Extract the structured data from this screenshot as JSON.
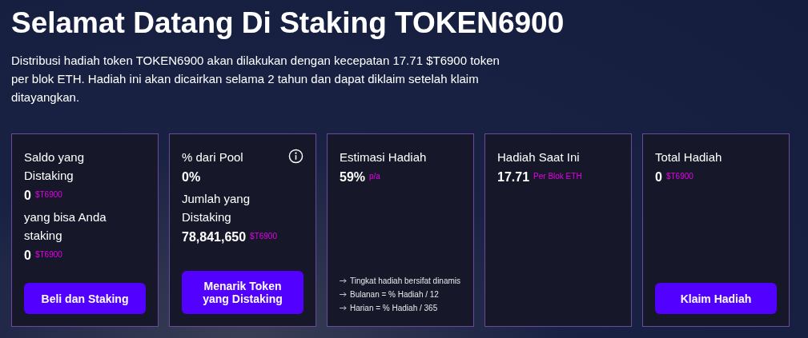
{
  "title": "Selamat Datang Di Staking TOKEN6900",
  "description": "Distribusi hadiah token TOKEN6900 akan dilakukan dengan kecepatan 17.71 $T6900 token per blok ETH. Hadiah ini akan dicairkan selama 2 tahun dan dapat diklaim setelah klaim ditayangkan.",
  "cards": [
    {
      "stats": [
        {
          "label": "Saldo yang Distaking",
          "value": "0",
          "unit": "$T6900"
        },
        {
          "label": "yang bisa Anda staking",
          "value": "0",
          "unit": "$T6900"
        }
      ],
      "button": "Beli dan Staking"
    },
    {
      "info_icon": true,
      "stats": [
        {
          "label": "% dari Pool",
          "value": "0%"
        },
        {
          "label": "Jumlah yang Distaking",
          "value": "78,841,650",
          "unit": "$T6900"
        }
      ],
      "button": "Menarik Token yang Distaking"
    },
    {
      "stats": [
        {
          "label": "Estimasi Hadiah",
          "value": "59%",
          "unit": "p/a"
        }
      ],
      "notes": [
        "Tingkat hadiah bersifat dinamis",
        "Bulanan = % Hadiah / 12",
        "Harian = % Hadiah / 365"
      ]
    },
    {
      "stats": [
        {
          "label": "Hadiah Saat Ini",
          "value": "17.71",
          "unit": "Per Blok ETH"
        }
      ]
    },
    {
      "stats": [
        {
          "label": "Total Hadiah",
          "value": "0",
          "unit": "$T6900"
        }
      ],
      "button": "Klaim Hadiah"
    }
  ]
}
